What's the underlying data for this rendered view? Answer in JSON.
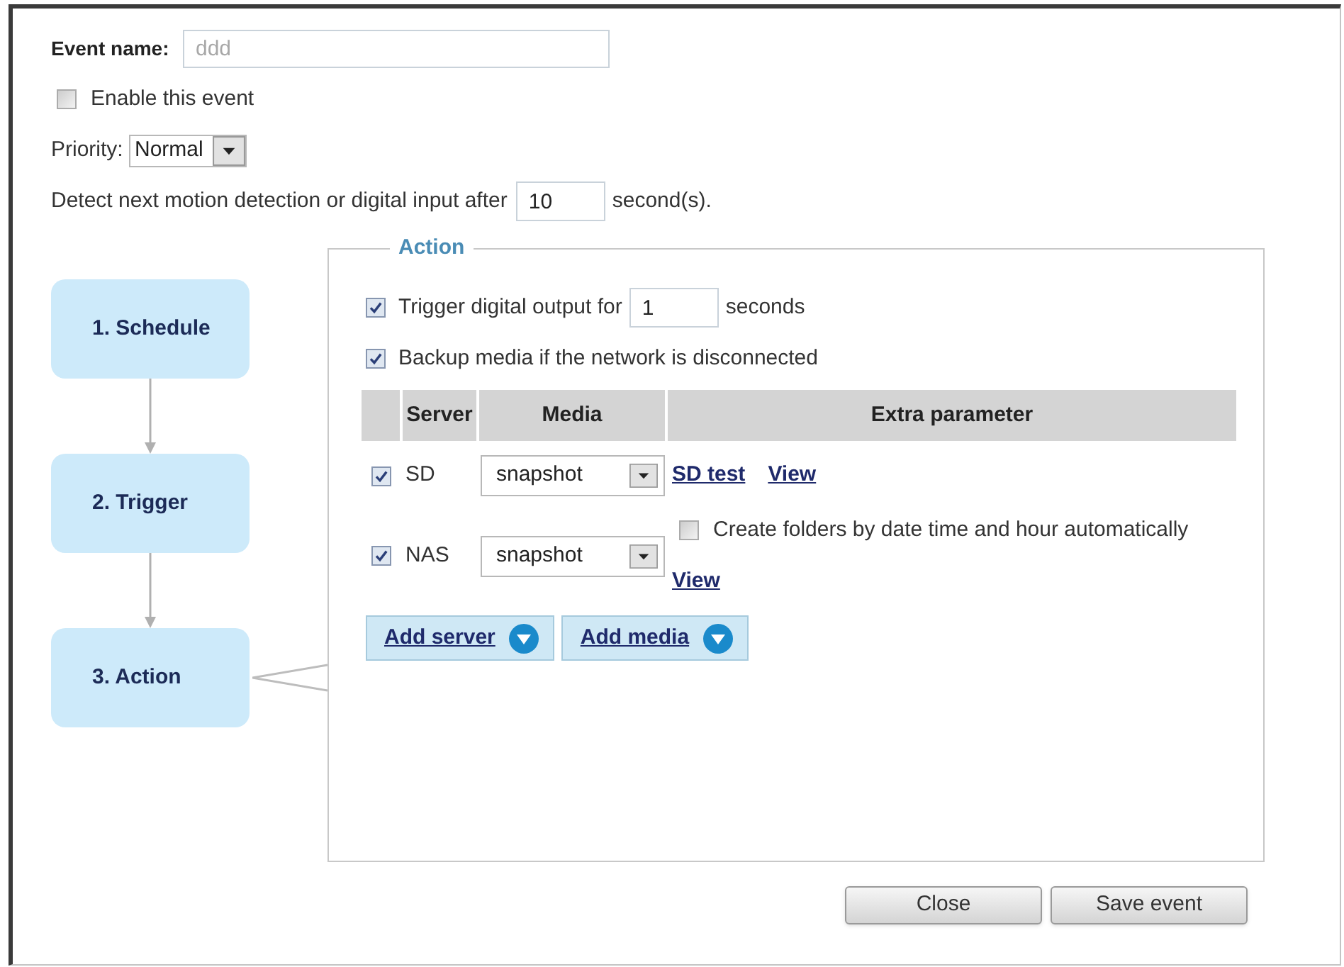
{
  "event_name": {
    "label": "Event name:",
    "placeholder": "ddd"
  },
  "enable_event": {
    "label": "Enable this event",
    "checked": false
  },
  "priority": {
    "label": "Priority:",
    "value": "Normal"
  },
  "detect_interval": {
    "label": "Detect next motion detection or digital input after",
    "value": "10",
    "unit": "second(s)."
  },
  "steps": [
    {
      "label": "1. Schedule",
      "selected": false
    },
    {
      "label": "2. Trigger",
      "selected": false
    },
    {
      "label": "3. Action",
      "selected": true
    }
  ],
  "action": {
    "legend": "Action",
    "trigger_output": {
      "checked": true,
      "label": "Trigger digital output for",
      "value": "1",
      "unit": "seconds"
    },
    "backup_media": {
      "checked": true,
      "label": "Backup media if the network is disconnected"
    },
    "table": {
      "columns": [
        "Server",
        "Media",
        "Extra parameter"
      ],
      "rows": [
        {
          "checked": true,
          "server": "SD",
          "media": "snapshot",
          "extra": [
            {
              "kind": "link",
              "label": "SD test"
            },
            {
              "kind": "link",
              "label": "View"
            }
          ]
        },
        {
          "checked": true,
          "server": "NAS",
          "media": "snapshot",
          "extra": [
            {
              "kind": "checkbox",
              "label": "Create folders by date time and hour automatically",
              "checked": false
            },
            {
              "kind": "link",
              "label": "View"
            }
          ]
        }
      ]
    },
    "add_buttons": [
      "Add server",
      "Add media"
    ]
  },
  "buttons": [
    "Close",
    "Save event"
  ]
}
